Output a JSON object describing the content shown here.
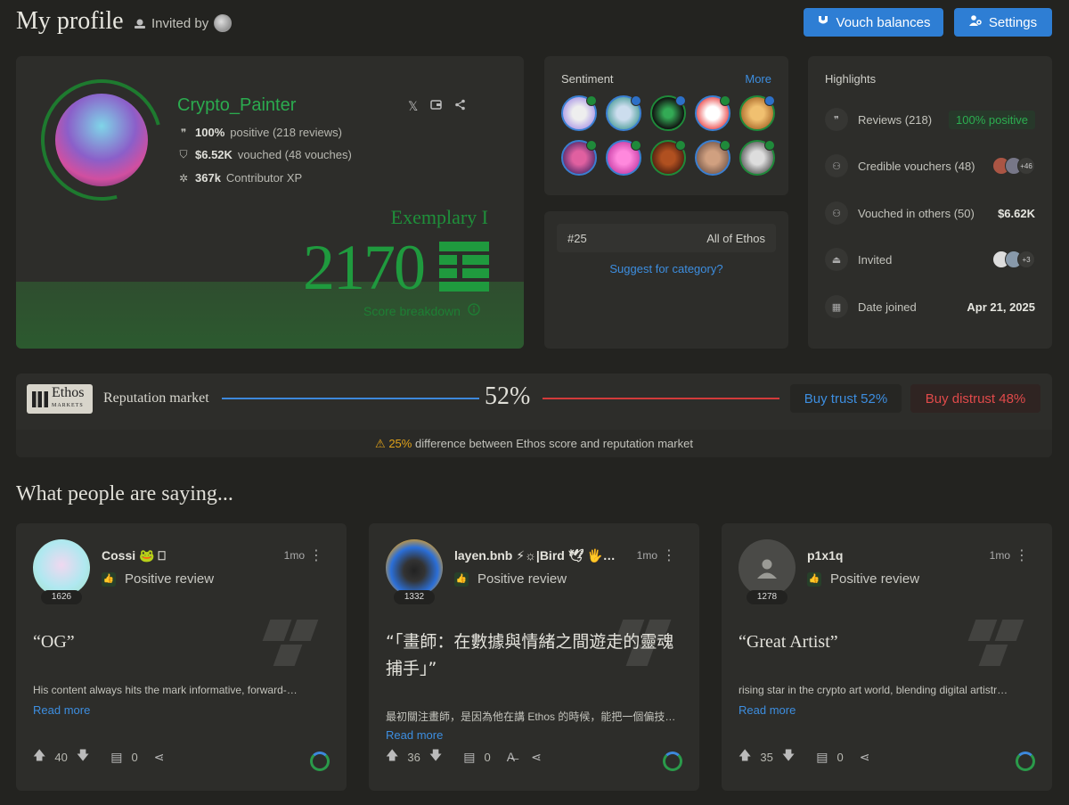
{
  "header": {
    "title": "My profile",
    "invited_label": "Invited by",
    "vouch_button": "Vouch balances",
    "settings_button": "Settings"
  },
  "profile": {
    "username": "Crypto_Painter",
    "reviews_pct": "100%",
    "reviews_text": "positive (218 reviews)",
    "vouched_amount": "$6.52K",
    "vouched_text": "vouched (48 vouches)",
    "xp_amount": "367k",
    "xp_text": "Contributor XP",
    "level": "Exemplary I",
    "score": "2170",
    "score_breakdown": "Score breakdown"
  },
  "sentiment": {
    "title": "Sentiment",
    "more": "More"
  },
  "rank": {
    "position": "#25",
    "category": "All of Ethos",
    "suggest": "Suggest for category?"
  },
  "highlights": {
    "title": "Highlights",
    "reviews_label": "Reviews (218)",
    "reviews_badge": "100% positive",
    "credible_label": "Credible vouchers (48)",
    "credible_more": "+46",
    "vouched_label": "Vouched in others (50)",
    "vouched_value": "$6.62K",
    "invited_label": "Invited",
    "invited_more": "+3",
    "joined_label": "Date joined",
    "joined_value": "Apr 21, 2025"
  },
  "market": {
    "logo_text": "Ethos",
    "logo_sub": "MARKETS",
    "label": "Reputation market",
    "percent": "52%",
    "buy_trust": "Buy trust 52%",
    "buy_distrust": "Buy distrust 48%",
    "diff_pct": "25%",
    "diff_text": "difference between Ethos score and reputation market"
  },
  "reviews_section": {
    "title": "What people are saying...",
    "items": [
      {
        "name": "Cossi 🐸 ⎕",
        "score": "1626",
        "time": "1mo",
        "type": "Positive review",
        "quote": "“OG”",
        "body": "His content always hits the mark informative, forward-…",
        "more": "Read more",
        "upvotes": "40",
        "comments": "0"
      },
      {
        "name": "layen.bnb ⚡☼|Bird 🕊 🖐…",
        "score": "1332",
        "time": "1mo",
        "type": "Positive review",
        "quote": "“「畫師：在數據與情緒之間遊走的靈魂捕手」”",
        "body": "最初關注畫師，是因為他在講 Ethos 的時候，能把一個偏技…",
        "more": "Read more",
        "upvotes": "36",
        "comments": "0"
      },
      {
        "name": "p1x1q",
        "score": "1278",
        "time": "1mo",
        "type": "Positive review",
        "quote": "“Great Artist”",
        "body": "rising star in the crypto art world, blending digital artistr…",
        "more": "Read more",
        "upvotes": "35",
        "comments": "0"
      }
    ]
  },
  "colors": {
    "background": "#232320",
    "card": "#2d2d2a",
    "accent_blue": "#2e7ed4",
    "score_green": "#1f9a3e",
    "distrust_red": "#d23a3a"
  }
}
